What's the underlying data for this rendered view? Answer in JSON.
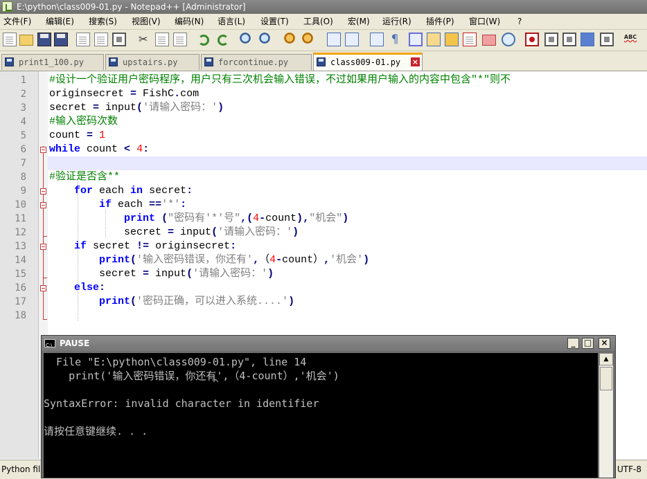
{
  "window": {
    "title": "E:\\python\\class009-01.py - Notepad++ [Administrator]"
  },
  "menu": [
    "文件(F)",
    "编辑(E)",
    "搜索(S)",
    "视图(V)",
    "编码(N)",
    "语言(L)",
    "设置(T)",
    "工具(O)",
    "宏(M)",
    "运行(R)",
    "插件(P)",
    "窗口(W)",
    "?"
  ],
  "toolbar": {
    "icons": [
      "new-file-icon",
      "open-folder-icon",
      "save-icon",
      "save-all-icon",
      "close-icon",
      "close-all-icon",
      "print-icon",
      "cut-icon",
      "copy-icon",
      "paste-icon",
      "undo-icon",
      "redo-icon",
      "find-icon",
      "replace-icon",
      "zoom-in-icon",
      "zoom-out-icon",
      "sync-vertical-icon",
      "sync-horizontal-icon",
      "word-wrap-icon",
      "show-all-chars-icon",
      "indent-guide-icon",
      "user-language-icon",
      "doc-map-icon",
      "function-list-icon",
      "folder-workspace-icon",
      "monitoring-icon",
      "record-macro-icon",
      "stop-record-icon",
      "playback-macro-icon",
      "run-macro-multiple-icon",
      "save-macro-icon",
      "spell-check-icon"
    ]
  },
  "tabs": [
    {
      "label": "print1_100.py",
      "active": false
    },
    {
      "label": "upstairs.py",
      "active": false
    },
    {
      "label": "forcontinue.py",
      "active": false
    },
    {
      "label": "class009-01.py",
      "active": true
    }
  ],
  "editor": {
    "current_line": 7,
    "lines": [
      {
        "n": "1",
        "code": "#设计一个验证用户密码程序，用户只有三次机会输入错误，不过如果用户输入的内容中包含\"*\"则不"
      },
      {
        "n": "2",
        "code": "originsecret = FishC.com"
      },
      {
        "n": "3",
        "code": "secret = input('请输入密码：')"
      },
      {
        "n": "4",
        "code": "#输入密码次数"
      },
      {
        "n": "5",
        "code": "count = 1"
      },
      {
        "n": "6",
        "code": "while count < 4:"
      },
      {
        "n": "7",
        "code": ""
      },
      {
        "n": "8",
        "code": "#验证是否含**"
      },
      {
        "n": "9",
        "code": "    for each in secret:"
      },
      {
        "n": "10",
        "code": "        if each =='*':"
      },
      {
        "n": "11",
        "code": "            print (\"密码有'*'号\",(4-count),\"机会\")"
      },
      {
        "n": "12",
        "code": "            secret = input('请输入密码：')"
      },
      {
        "n": "13",
        "code": "    if secret != originsecret:"
      },
      {
        "n": "14",
        "code": "        print('输入密码错误，你还有',（4-count）,'机会')"
      },
      {
        "n": "15",
        "code": "        secret = input('请输入密码：')"
      },
      {
        "n": "16",
        "code": "    else:"
      },
      {
        "n": "17",
        "code": "        print('密码正确，可以进入系统....')"
      },
      {
        "n": "18",
        "code": ""
      }
    ]
  },
  "status": {
    "left": "Python fil",
    "right": "UTF-8"
  },
  "console": {
    "title": "PAUSE",
    "lines": [
      "  File \"E:\\python\\class009-01.py\", line 14",
      "    print('输入密码错误，你还有',（4-count）,'机会')",
      "                           ^",
      "SyntaxError: invalid character in identifier",
      "",
      "请按任意键继续. . ."
    ]
  }
}
